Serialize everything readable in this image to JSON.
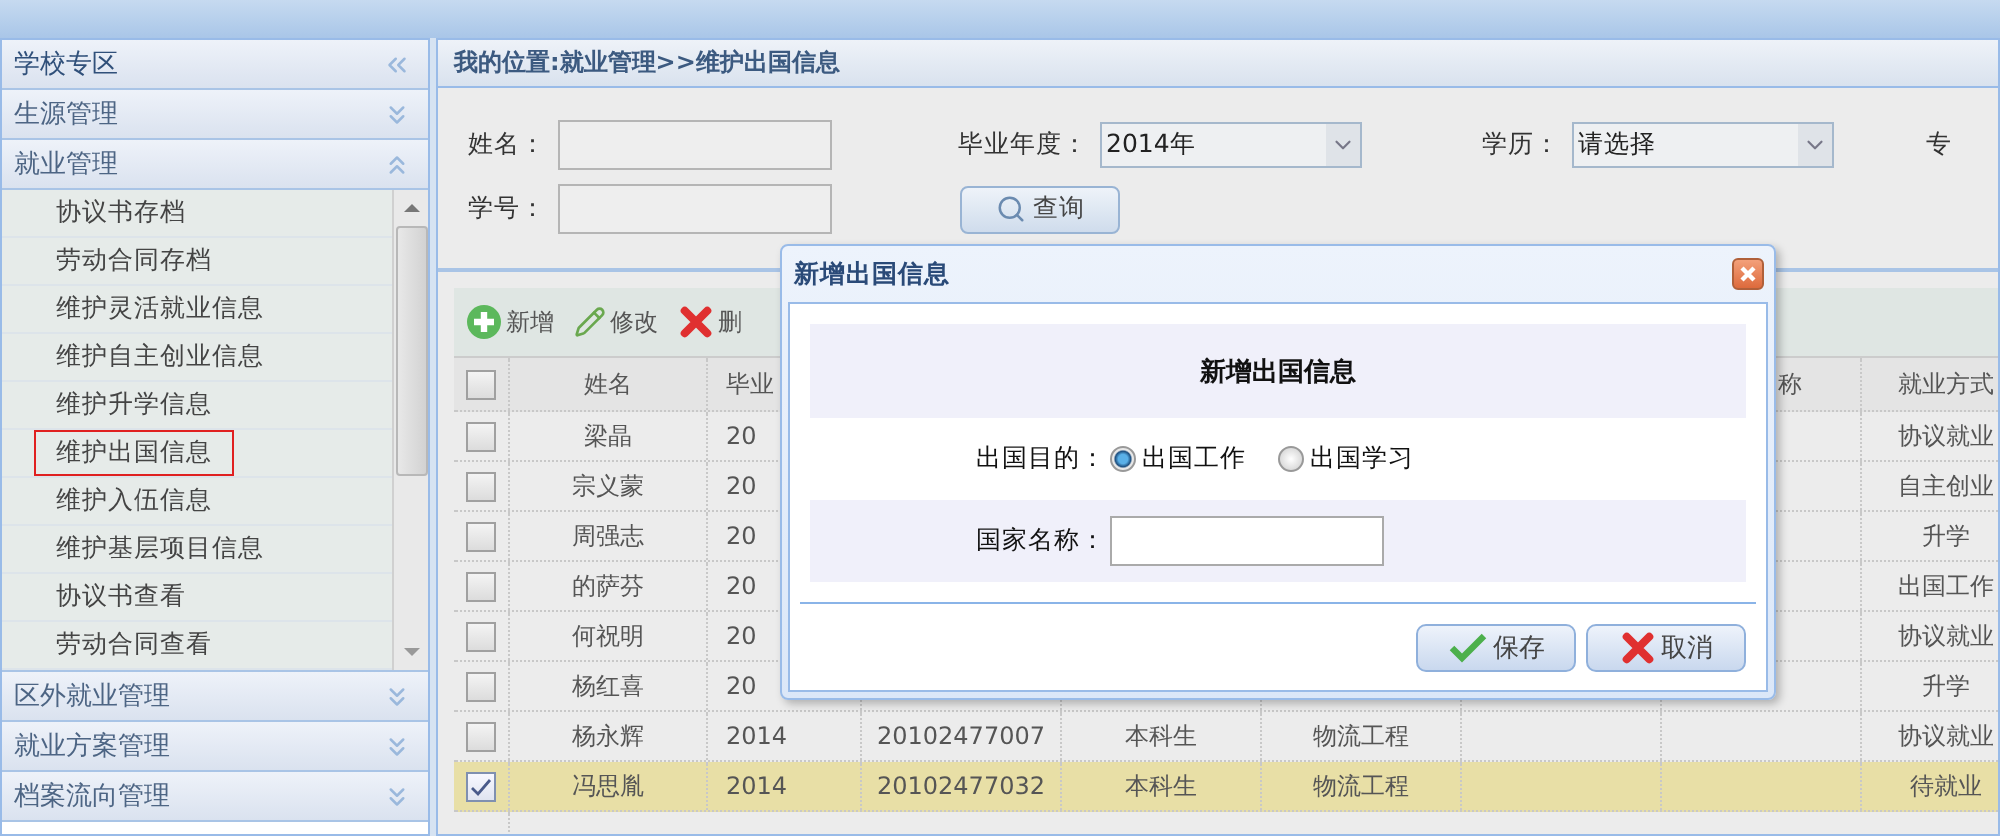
{
  "sidebar": {
    "title": "学校专区",
    "sections": [
      {
        "label": "生源管理",
        "expanded": false
      },
      {
        "label": "就业管理",
        "expanded": true,
        "items": [
          {
            "label": "协议书存档",
            "selected": false
          },
          {
            "label": "劳动合同存档",
            "selected": false
          },
          {
            "label": "维护灵活就业信息",
            "selected": false
          },
          {
            "label": "维护自主创业信息",
            "selected": false
          },
          {
            "label": "维护升学信息",
            "selected": false
          },
          {
            "label": "维护出国信息",
            "selected": true
          },
          {
            "label": "维护入伍信息",
            "selected": false
          },
          {
            "label": "维护基层项目信息",
            "selected": false
          },
          {
            "label": "协议书查看",
            "selected": false
          },
          {
            "label": "劳动合同查看",
            "selected": false
          }
        ]
      },
      {
        "label": "区外就业管理",
        "expanded": false
      },
      {
        "label": "就业方案管理",
        "expanded": false
      },
      {
        "label": "档案流向管理",
        "expanded": false
      }
    ]
  },
  "breadcrumb": "我的位置:就业管理>>维护出国信息",
  "search": {
    "row1": [
      {
        "kind": "text",
        "label": "姓名："
      },
      {
        "kind": "select",
        "label": "毕业年度：",
        "value": "2014年"
      },
      {
        "kind": "select",
        "label": "学历：",
        "value": "请选择"
      },
      {
        "kind": "label",
        "label": "专"
      }
    ],
    "row2": [
      {
        "kind": "text",
        "label": "学号："
      },
      {
        "kind": "button",
        "label": "查询"
      }
    ]
  },
  "toolbar": [
    {
      "kind": "add",
      "label": "新增"
    },
    {
      "kind": "edit",
      "label": "修改"
    },
    {
      "kind": "delete",
      "label": "删"
    }
  ],
  "table": {
    "header": {
      "checked": false,
      "name": "姓名",
      "year": "毕业",
      "column_8": "称",
      "employment": "就业方式"
    },
    "rows": [
      {
        "checked": false,
        "selected": false,
        "name": "梁晶",
        "year": "20",
        "employment": "协议就业"
      },
      {
        "checked": false,
        "selected": false,
        "name": "宗义蒙",
        "year": "20",
        "employment": "自主创业"
      },
      {
        "checked": false,
        "selected": false,
        "name": "周强志",
        "year": "20",
        "employment": "升学"
      },
      {
        "checked": false,
        "selected": false,
        "name": "的萨芬",
        "year": "20",
        "employment": "出国工作"
      },
      {
        "checked": false,
        "selected": false,
        "name": "何祝明",
        "year": "20",
        "employment": "协议就业"
      },
      {
        "checked": false,
        "selected": false,
        "name": "杨红喜",
        "year": "20",
        "employment": "升学"
      },
      {
        "checked": false,
        "selected": false,
        "name": "杨永辉",
        "year": "2014",
        "student_id": "20102477007",
        "education": "本科生",
        "major": "物流工程",
        "employment": "协议就业"
      },
      {
        "checked": true,
        "selected": true,
        "name": "冯思胤",
        "year": "2014",
        "student_id": "20102477032",
        "education": "本科生",
        "major": "物流工程",
        "employment": "待就业"
      }
    ]
  },
  "dialog": {
    "title": "新增出国信息",
    "heading": "新增出国信息",
    "purpose": {
      "label": "出国目的：",
      "options": [
        {
          "label": "出国工作",
          "selected": true
        },
        {
          "label": "出国学习",
          "selected": false
        }
      ]
    },
    "country": {
      "label": "国家名称："
    },
    "buttons": [
      {
        "kind": "save",
        "label": "保存"
      },
      {
        "kind": "cancel",
        "label": "取消"
      }
    ]
  }
}
